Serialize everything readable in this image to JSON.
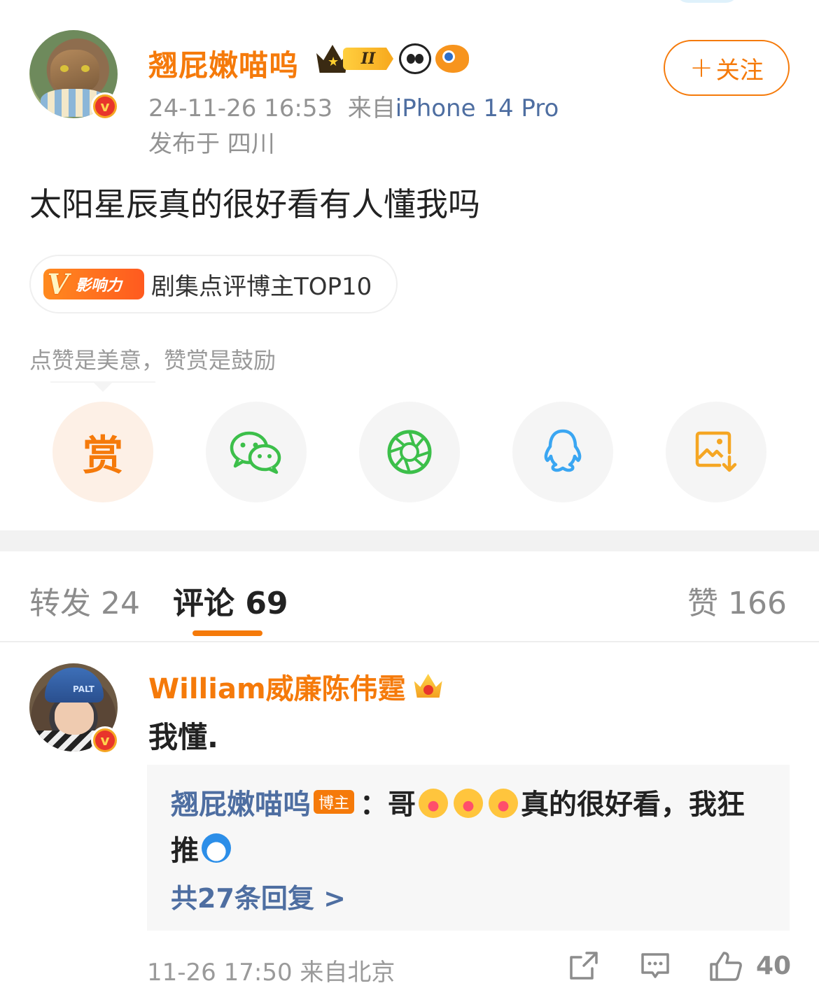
{
  "post": {
    "username": "翘屁嫩喵呜",
    "level_badge": "II",
    "meta": {
      "datetime": "24-11-26 16:53",
      "source_prefix": "来自",
      "device": "iPhone 14 Pro",
      "location": "发布于 四川"
    },
    "follow_label": "关注",
    "content": "太阳星辰真的很好看有人懂我吗",
    "influence": {
      "badge_v": "V",
      "badge_text": "影响力",
      "title": "剧集点评博主TOP10"
    },
    "reward_hint": "点赞是美意，赞赏是鼓励",
    "share": {
      "reward_label": "赏",
      "icons": [
        "wechat-icon",
        "moments-icon",
        "qq-icon",
        "save-image-icon"
      ]
    }
  },
  "tabs": {
    "repost": "转发 24",
    "comments": "评论 69",
    "likes": "赞 166"
  },
  "comment": {
    "username": "William威廉陈伟霆",
    "text": "我懂.",
    "reply": {
      "name": "翘屁嫩喵呜",
      "author_tag": "博主",
      "prefix": "：哥",
      "text_a": "真的很好看，我狂",
      "text_b": "推",
      "more": "共27条回复 >"
    },
    "footer": "11-26 17:50  来自北京",
    "like_count": "40"
  },
  "colors": {
    "accent": "#f57a0a",
    "link": "#4e6ea1",
    "muted": "#939393",
    "wechat": "#3cbf4a",
    "qq": "#3aa6f2"
  }
}
